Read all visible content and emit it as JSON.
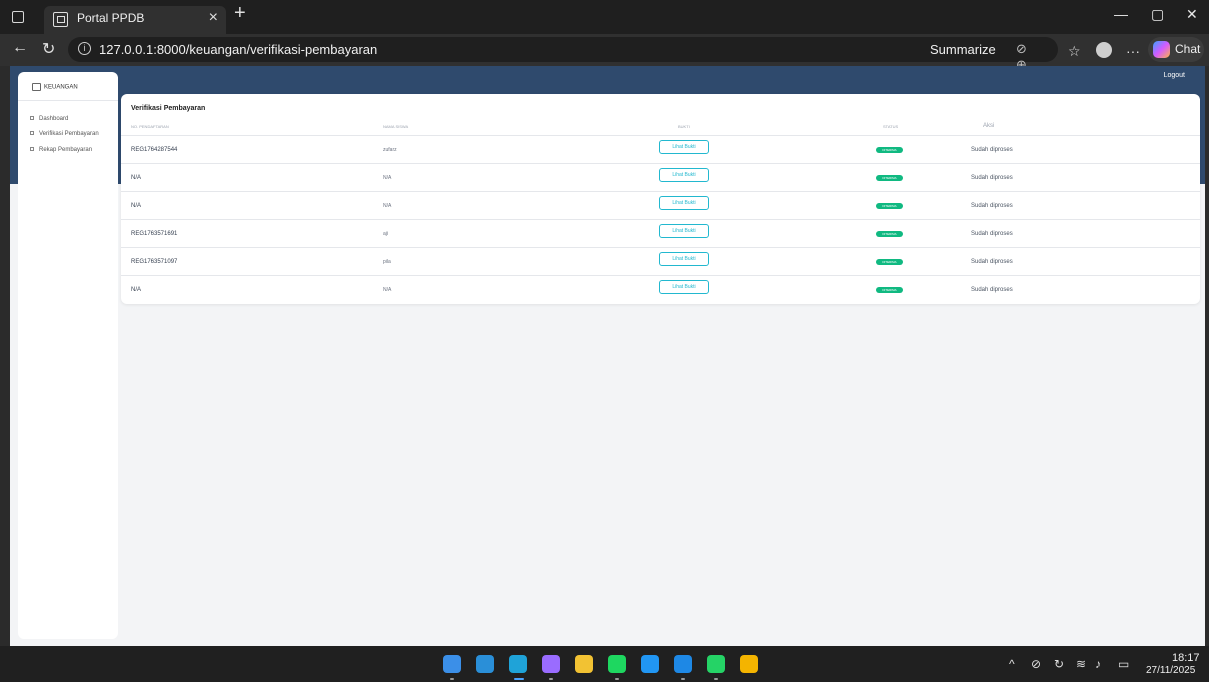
{
  "browser": {
    "tab_title": "Portal PPDB",
    "tab_close": "×",
    "new_tab": "+",
    "url": "127.0.0.1:8000/keuangan/verifikasi-pembayaran",
    "summarize_label": "Summarize",
    "chat_label": "Chat",
    "window_minimize": "—",
    "window_restore": "▢",
    "window_close": "✕"
  },
  "app": {
    "brand": "KEUANGAN",
    "logout_label": "Logout",
    "nav": [
      {
        "label": "Dashboard"
      },
      {
        "label": "Verifikasi Pembayaran"
      },
      {
        "label": "Rekap Pembayaran"
      }
    ]
  },
  "card": {
    "title": "Verifikasi Pembayaran",
    "columns": [
      "No. Pendaftaran",
      "Nama Siswa",
      "Bukti",
      "Status",
      "Aksi"
    ],
    "rows": [
      {
        "reg": "REG1764287544",
        "name": "zufarz",
        "button": "Lihat Bukti",
        "status": "Diterima",
        "aksi": "Sudah diproses"
      },
      {
        "reg": "N/A",
        "name": "N/A",
        "button": "Lihat Bukti",
        "status": "Diterima",
        "aksi": "Sudah diproses"
      },
      {
        "reg": "N/A",
        "name": "N/A",
        "button": "Lihat Bukti",
        "status": "Diterima",
        "aksi": "Sudah diproses"
      },
      {
        "reg": "REG1763571691",
        "name": "aji",
        "button": "Lihat Bukti",
        "status": "Diterima",
        "aksi": "Sudah diproses"
      },
      {
        "reg": "REG1763571097",
        "name": "pila",
        "button": "Lihat Bukti",
        "status": "Diterima",
        "aksi": "Sudah diproses"
      },
      {
        "reg": "N/A",
        "name": "N/A",
        "button": "Lihat Bukti",
        "status": "Diterima",
        "aksi": "Sudah diproses"
      }
    ]
  },
  "taskbar": {
    "time": "18:17",
    "date": "27/11/2025",
    "apps": [
      {
        "name": "windows-start",
        "color": "#3b8fe8"
      },
      {
        "name": "vscode",
        "color": "#2a8fd8"
      },
      {
        "name": "edge",
        "color": "#1fa3d8"
      },
      {
        "name": "copilot",
        "color": "#9a6cff"
      },
      {
        "name": "file-explorer",
        "color": "#f2c233"
      },
      {
        "name": "spotify",
        "color": "#1ed760"
      },
      {
        "name": "app-blue",
        "color": "#2196f3"
      },
      {
        "name": "app-photos",
        "color": "#1e88e5"
      },
      {
        "name": "whatsapp",
        "color": "#25d366"
      },
      {
        "name": "chrome",
        "color": "#f4b400"
      }
    ]
  },
  "colors": {
    "header": "#2f4a6d",
    "accent": "#22b8cf",
    "success": "#10b981"
  }
}
